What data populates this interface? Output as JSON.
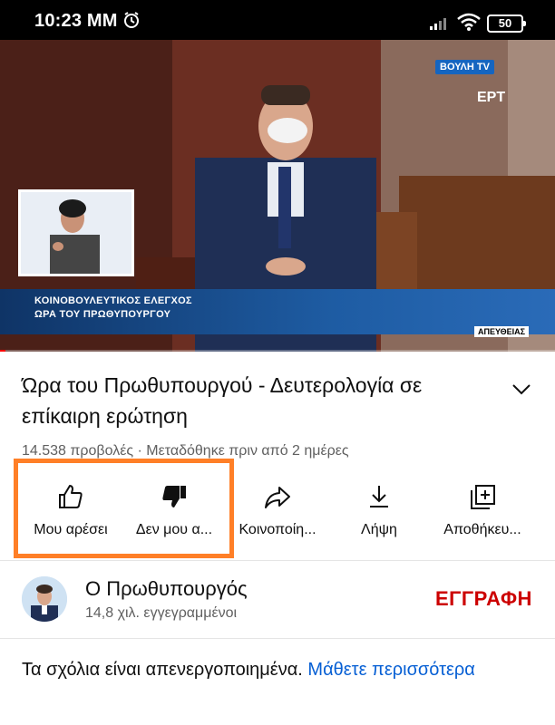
{
  "status_bar": {
    "time": "10:23 MM",
    "battery": "50"
  },
  "video": {
    "channel_logo": "ΒΟΥΛΗ TV",
    "network_logo": "ΕΡΤ",
    "ticker_line1": "ΚΟΙΝΟΒΟΥΛΕΥΤΙΚΟΣ ΕΛΕΓΧΟΣ",
    "ticker_line2": "ΩΡΑ ΤΟΥ ΠΡΩΘΥΠΟΥΡΓΟΥ",
    "live_tag": "ΑΠΕΥΘΕΙΑΣ",
    "progress": 0.01
  },
  "title": "Ώρα του Πρωθυπουργού - Δευτερολογία σε επίκαιρη ερώτηση",
  "meta": "14.538 προβολές · Μεταδόθηκε πριν από 2 ημέρες",
  "actions": {
    "like": "Μου αρέσει",
    "dislike": "Δεν μου α...",
    "share": "Κοινοποίη...",
    "download": "Λήψη",
    "save": "Αποθήκευ..."
  },
  "channel": {
    "name": "Ο Πρωθυπουργός",
    "subscribers": "14,8 χιλ. εγγεγραμμένοι",
    "subscribe_label": "ΕΓΓΡΑΦΗ"
  },
  "comments": {
    "disabled_text": "Τα σχόλια είναι απενεργοποιημένα.",
    "learn_more": "Μάθετε περισσότερα"
  },
  "colors": {
    "accent_red": "#cc0000",
    "link_blue": "#065fd4",
    "highlight_orange": "#ff7f27"
  }
}
